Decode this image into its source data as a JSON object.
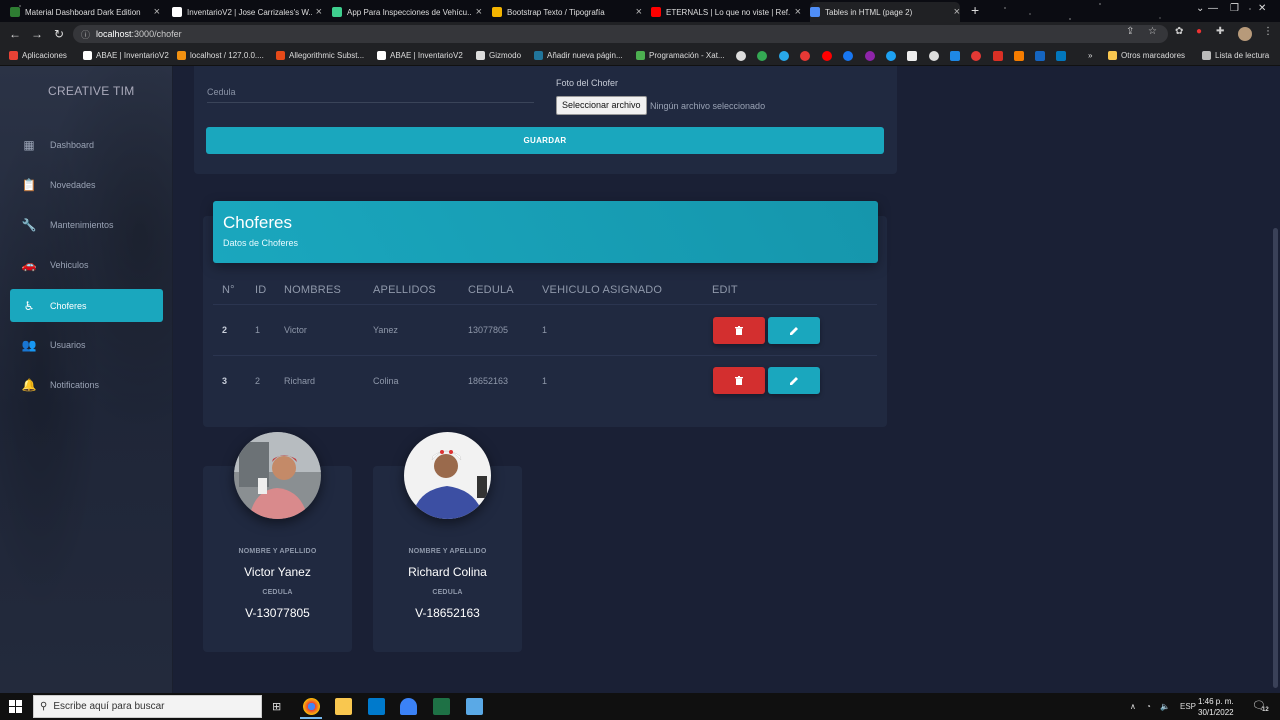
{
  "browser": {
    "tabs": [
      {
        "title": "Material Dashboard Dark Edition",
        "color": "#2e7d32"
      },
      {
        "title": "InventarioV2 | Jose Carrizales's W...",
        "color": "#ffffff"
      },
      {
        "title": "App Para Inspecciones de Vehícu...",
        "color": "#3ecf8e"
      },
      {
        "title": "Bootstrap Texto / Tipografía",
        "color": "#f4b400"
      },
      {
        "title": "ETERNALS | Lo que no viste | Ref...",
        "color": "#ff0000"
      },
      {
        "title": "Tables in HTML (page 2)",
        "color": "#4f8ef7"
      }
    ],
    "url_host": "localhost",
    "url_path": ":3000/chofer",
    "bookmarks": [
      {
        "label": "Aplicaciones",
        "color": "#e94235"
      },
      {
        "label": "ABAE | InventarioV2",
        "color": "#ffffff"
      },
      {
        "label": "localhost / 127.0.0....",
        "color": "#f29111"
      },
      {
        "label": "Allegorithmic Subst...",
        "color": "#e64a19"
      },
      {
        "label": "ABAE | InventarioV2",
        "color": "#ffffff"
      },
      {
        "label": "Gizmodo",
        "color": "#dddddd"
      },
      {
        "label": "Añadir nueva págin...",
        "color": "#21759b"
      },
      {
        "label": "Programación - Xat...",
        "color": "#4caf50"
      }
    ],
    "other_bookmarks": "Otros marcadores",
    "reading_list": "Lista de lectura"
  },
  "sidebar": {
    "brand": "CREATIVE TIM",
    "items": [
      {
        "label": "Dashboard",
        "icon": "▦"
      },
      {
        "label": "Novedades",
        "icon": "📋"
      },
      {
        "label": "Mantenimientos",
        "icon": "🔧"
      },
      {
        "label": "Vehiculos",
        "icon": "🚗"
      },
      {
        "label": "Choferes",
        "icon": "♿"
      },
      {
        "label": "Usuarios",
        "icon": "👥"
      },
      {
        "label": "Notifications",
        "icon": "🔔"
      }
    ]
  },
  "form": {
    "cedula_label": "Cedula",
    "foto_label": "Foto del Chofer",
    "file_button": "Seleccionar archivo",
    "file_status": "Ningún archivo seleccionado",
    "save_button": "GUARDAR"
  },
  "table": {
    "title": "Choferes",
    "subtitle": "Datos de Choferes",
    "headers": [
      "N°",
      "ID",
      "NOMBRES",
      "APELLIDOS",
      "CEDULA",
      "VEHICULO ASIGNADO",
      "EDIT"
    ],
    "rows": [
      {
        "n": "2",
        "id": "1",
        "nombres": "Victor",
        "apellidos": "Yanez",
        "cedula": "13077805",
        "vehiculo": "1"
      },
      {
        "n": "3",
        "id": "2",
        "nombres": "Richard",
        "apellidos": "Colina",
        "cedula": "18652163",
        "vehiculo": "1"
      }
    ]
  },
  "profiles": [
    {
      "name_label": "NOMBRE Y APELLIDO",
      "name": "Victor Yanez",
      "cedula_label": "CEDULA",
      "cedula": "V-13077805"
    },
    {
      "name_label": "NOMBRE Y APELLIDO",
      "name": "Richard Colina",
      "cedula_label": "CEDULA",
      "cedula": "V-18652163"
    }
  ],
  "taskbar": {
    "search_placeholder": "Escribe aquí para buscar",
    "lang": "ESP",
    "time": "1:46 p. m.",
    "date": "30/1/2022",
    "notif_count": "12"
  },
  "colors": {
    "accent": "#1aa7be",
    "danger": "#d32f2f",
    "background": "#1a2035",
    "card": "#202940"
  }
}
